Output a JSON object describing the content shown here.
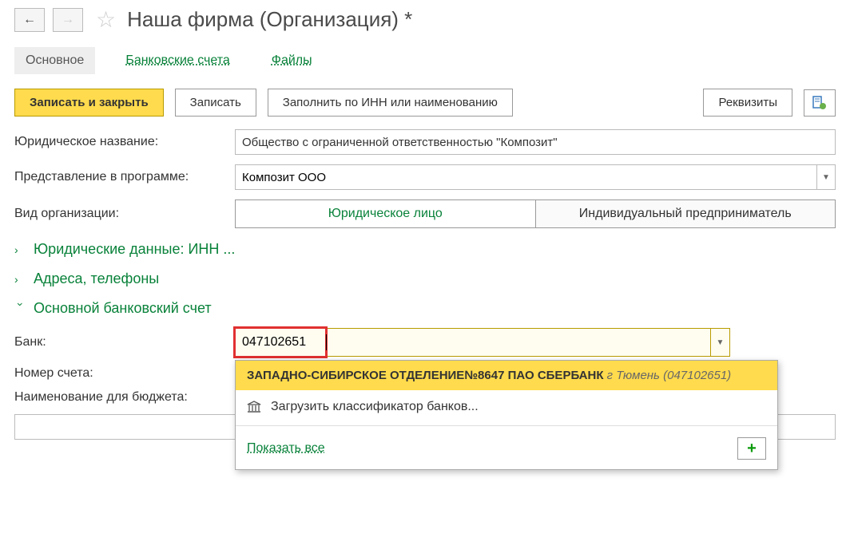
{
  "header": {
    "title": "Наша фирма (Организация) *"
  },
  "tabs": {
    "main": "Основное",
    "bank_accounts": "Банковские счета",
    "files": "Файлы"
  },
  "toolbar": {
    "save_close": "Записать и закрыть",
    "save": "Записать",
    "fill_by_inn": "Заполнить по ИНН или наименованию",
    "requisites": "Реквизиты"
  },
  "fields": {
    "legal_name_label": "Юридическое название:",
    "legal_name_value": "Общество с ограниченной ответственностью \"Композит\"",
    "presentation_label": "Представление в программе:",
    "presentation_value": "Композит ООО",
    "org_type_label": "Вид организации:",
    "org_type_legal": "Юридическое лицо",
    "org_type_individual": "Индивидуальный предприниматель"
  },
  "sections": {
    "legal_data": "Юридические данные: ИНН ...",
    "addresses": "Адреса, телефоны",
    "bank_account": "Основной банковский счет"
  },
  "bank": {
    "label": "Банк:",
    "search_value": "047102651",
    "dropdown": {
      "result_name": "ЗАПАДНО-СИБИРСКОЕ ОТДЕЛЕНИЕ№8647 ПАО СБЕРБАНК",
      "result_city": "г Тюмень",
      "result_code": "(047102651)",
      "load_classifier": "Загрузить классификатор банков...",
      "show_all": "Показать все"
    },
    "account_label": "Номер счета:",
    "budget_name_label": "Наименование для бюджета:"
  }
}
